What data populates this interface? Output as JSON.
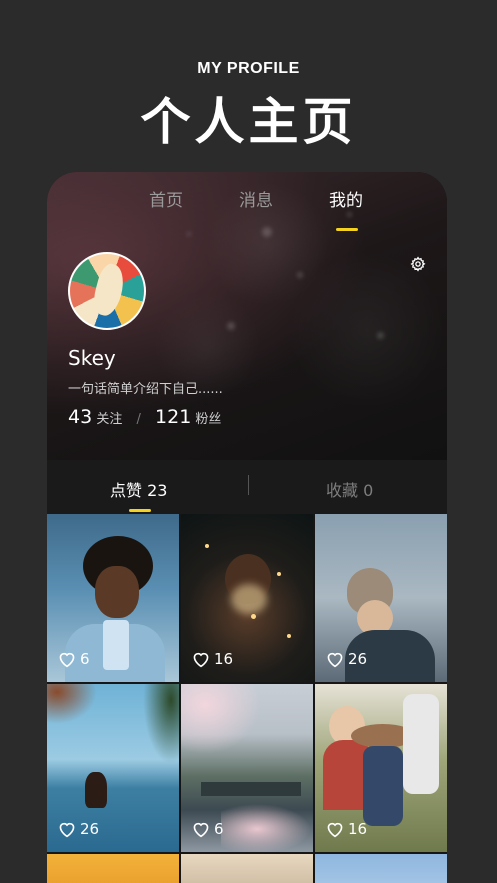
{
  "hero": {
    "subtitle": "MY PROFILE",
    "title": "个人主页"
  },
  "top_tabs": [
    {
      "label": "首页"
    },
    {
      "label": "消息"
    },
    {
      "label": "我的"
    }
  ],
  "profile": {
    "name": "Skey",
    "bio": "一句话简单介绍下自己......",
    "following_count": "43",
    "following_label": "关注",
    "separator": "/",
    "followers_count": "121",
    "followers_label": "粉丝"
  },
  "sub_tabs": [
    {
      "label": "点赞 23"
    },
    {
      "label": "收藏 0"
    }
  ],
  "photos": [
    {
      "likes": "6"
    },
    {
      "likes": "16"
    },
    {
      "likes": "26"
    },
    {
      "likes": "26"
    },
    {
      "likes": "6"
    },
    {
      "likes": "16"
    }
  ],
  "colors": {
    "accent": "#f5d21e",
    "background": "#2b2b2b"
  },
  "icons": {
    "settings": "gear-icon",
    "like": "heart-icon"
  }
}
